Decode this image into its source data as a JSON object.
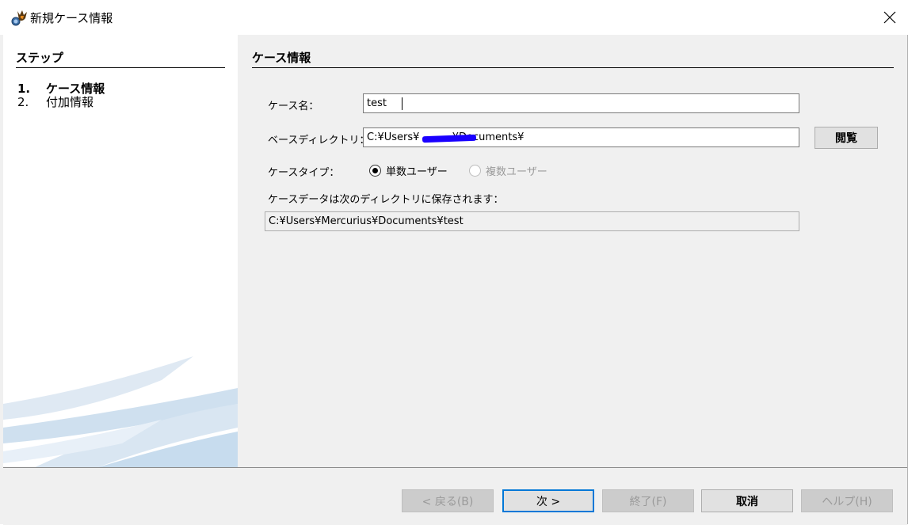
{
  "window": {
    "title": "新規ケース情報",
    "close_glyph": "✕",
    "icon": "app-logo-icon"
  },
  "steps": {
    "header": "ステップ",
    "items": [
      {
        "num": "1.",
        "label": "ケース情報",
        "active": true
      },
      {
        "num": "2.",
        "label": "付加情報",
        "active": false
      }
    ]
  },
  "case_info": {
    "header": "ケース情報",
    "case_name_label": "ケース名：",
    "case_name_value": "test",
    "base_dir_label": "ベースディレクトリ：",
    "base_dir_value": "C:¥Users¥          ¥Documents¥",
    "browse_label": "閲覧",
    "case_type_label": "ケースタイプ：",
    "single_user_label": "単数ユーザー",
    "multi_user_label": "複数ユーザー",
    "save_location_label": "ケースデータは次のディレクトリに保存されます：",
    "save_location_value": "C:¥Users¥Mercurius¥Documents¥test"
  },
  "buttons": {
    "back": "< 戻る(B)",
    "next": "次 >",
    "finish": "終了(F)",
    "cancel": "取消",
    "help": "ヘルプ(H)"
  },
  "colors": {
    "panel_bg": "#f0f0f0",
    "default_button_border": "#0078d7",
    "redaction": "#1a00ff"
  }
}
